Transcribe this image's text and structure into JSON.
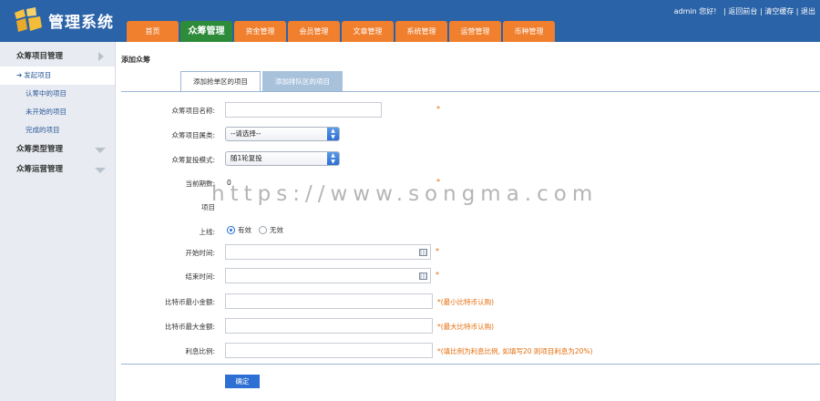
{
  "header": {
    "title": "管理系统",
    "nav": [
      "首页",
      "众筹管理",
      "资金管理",
      "会员管理",
      "文章管理",
      "系统管理",
      "运营管理",
      "币种管理"
    ],
    "active_nav_index": 1,
    "user": "admin",
    "greeting": "您好!",
    "links": [
      "返回前台",
      "清空缓存",
      "退出"
    ],
    "separator": "|"
  },
  "sidebar": {
    "groups": [
      {
        "label": "众筹项目管理",
        "items": [
          "发起项目",
          "认筹中的项目",
          "未开始的项目",
          "完成的项目"
        ]
      },
      {
        "label": "众筹类型管理"
      },
      {
        "label": "众筹运营管理"
      }
    ]
  },
  "main": {
    "title": "添加众筹",
    "tabs": [
      "添加抢单区的项目",
      "添加排队区的项目"
    ],
    "form": {
      "name_label": "众筹项目名称:",
      "category_label": "众筹项目属类:",
      "category_value": "--请选择--",
      "mode_label": "众筹复投模式:",
      "mode_value": "随1轮复投",
      "period_label": "当前期数:",
      "period_value": "0",
      "project_label": "项目",
      "online_label": "上线:",
      "online_options": [
        "有效",
        "无效"
      ],
      "start_label": "开始时间:",
      "end_label": "结束时间:",
      "min_label": "比特币最小金额:",
      "min_hint": "*(最小比特币认购)",
      "max_label": "比特币最大金额:",
      "max_hint": "*(最大比特币认购)",
      "rate_label": "利息比例:",
      "rate_hint": "*(填比例为利息比例, 如填写20 则项目利息为20%)",
      "required": "*",
      "submit": "确定"
    }
  },
  "watermark": "https://www.songma.com"
}
